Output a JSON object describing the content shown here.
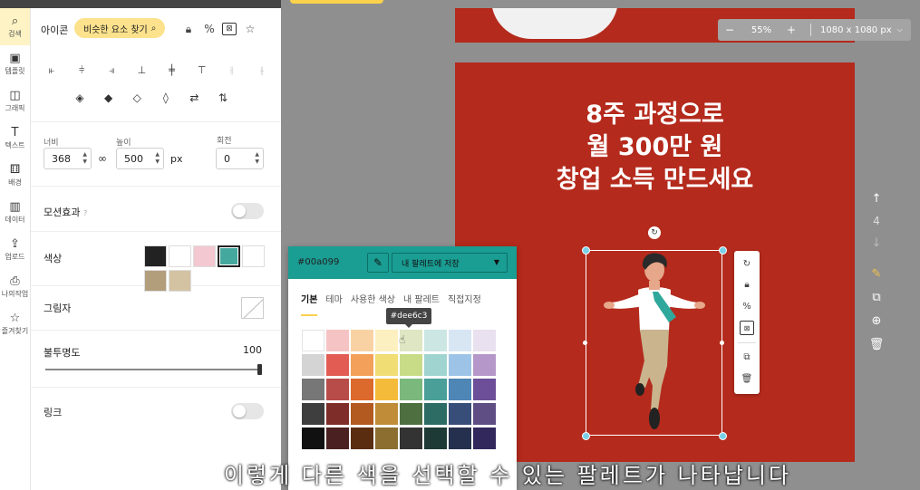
{
  "sidebar": {
    "items": [
      {
        "label": "검색",
        "icon": "search-icon",
        "glyph": "⌕",
        "active": true
      },
      {
        "label": "템플릿",
        "icon": "template-icon",
        "glyph": "▣"
      },
      {
        "label": "그래픽",
        "icon": "graphic-icon",
        "glyph": "◫"
      },
      {
        "label": "텍스트",
        "icon": "text-icon",
        "glyph": "T"
      },
      {
        "label": "배경",
        "icon": "background-icon",
        "glyph": "⚅"
      },
      {
        "label": "데이터",
        "icon": "data-icon",
        "glyph": "▥"
      },
      {
        "label": "업로드",
        "icon": "upload-icon",
        "glyph": "⇪"
      },
      {
        "label": "나의작업",
        "icon": "my-work-icon",
        "glyph": "⎙"
      },
      {
        "label": "즐겨찾기",
        "icon": "favorites-icon",
        "glyph": "☆"
      }
    ]
  },
  "panel": {
    "title": "아이콘",
    "similar_button": "비슷한 요소 찾기",
    "size": {
      "width_label": "너비",
      "width_value": "368",
      "height_label": "높이",
      "height_value": "500",
      "unit": "px",
      "rotate_label": "회전",
      "rotate_value": "0"
    },
    "motion_label": "모션효과",
    "color_label": "색상",
    "swatches": [
      "#222222",
      "#ffffff",
      "#f3c8d0",
      "#45a89e",
      "#ffffff",
      "#b39e7c",
      "#d3c3a3"
    ],
    "shadow_label": "그림자",
    "opacity_label": "불투명도",
    "opacity_value": "100",
    "opacity_level": 1.0,
    "link_label": "링크"
  },
  "zoom": {
    "minus": "−",
    "value": "55%",
    "plus": "+",
    "canvas_size": "1080 x 1080 px"
  },
  "canvas": {
    "headline_lines": [
      "8주 과정으로",
      "월 300만 원",
      "창업 소득 만드세요"
    ],
    "background": "#b42a1c"
  },
  "right_toolbar": {
    "page_number": "4"
  },
  "color_picker": {
    "hex": "#00a099",
    "save_button": "내 팔레트에 저장",
    "tabs": [
      "기본",
      "테마",
      "사용한 색상",
      "내 팔레트",
      "직접지정"
    ],
    "tooltip": "#dee6c3",
    "grid": [
      [
        "#ffffff",
        "#f6c3c4",
        "#f9d2a4",
        "#fdf0c0",
        "#dee6c3",
        "#cce6e4",
        "#d8e6f4",
        "#e9e1ef"
      ],
      [
        "#d4d4d4",
        "#e25c54",
        "#f3a05a",
        "#f0dd74",
        "#c8dc88",
        "#9fd4d0",
        "#9dc3e6",
        "#b598c9"
      ],
      [
        "#777777",
        "#b84c48",
        "#dc6a2c",
        "#f4bb3a",
        "#7ab87c",
        "#4aa098",
        "#4e86b6",
        "#6c4f98"
      ],
      [
        "#3e3e3e",
        "#7e2d28",
        "#b25a20",
        "#c08c38",
        "#4e7040",
        "#2c6c64",
        "#364e78",
        "#5e4e84"
      ],
      [
        "#111111",
        "#4a2020",
        "#5a2c10",
        "#8c6e30",
        "#333333",
        "#1e3a36",
        "#25304e",
        "#33285c"
      ]
    ]
  },
  "subtitle": "이렇게 다른 색을 선택할 수 있는 팔레트가 나타납니다"
}
